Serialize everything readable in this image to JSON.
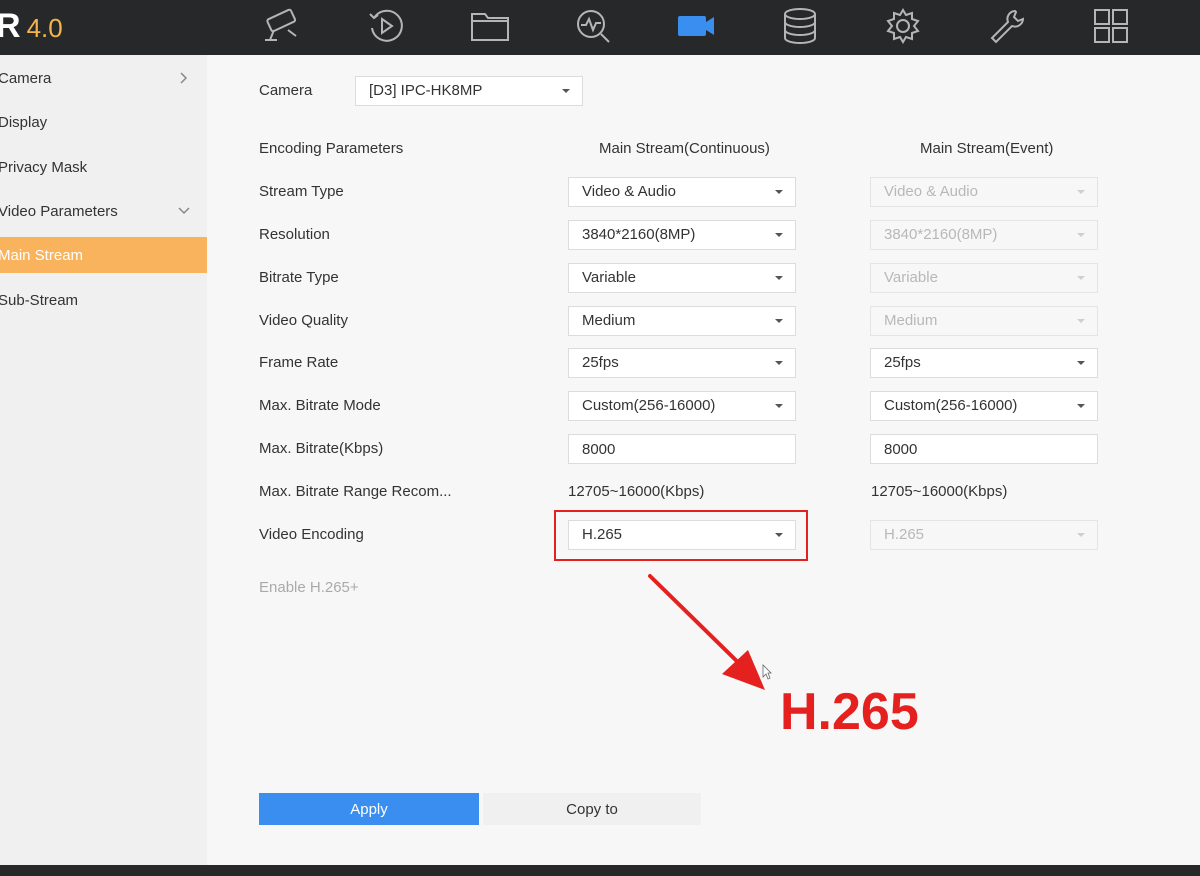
{
  "app": {
    "logo_letter": "R",
    "logo_version": "4.0"
  },
  "nav_icons": [
    "camera-icon",
    "playback-icon",
    "folder-icon",
    "search-analysis-icon",
    "video-icon",
    "storage-icon",
    "settings-icon",
    "maintenance-icon",
    "grid-icon"
  ],
  "sidebar": {
    "items": [
      {
        "label": "Camera"
      },
      {
        "label": "Display"
      },
      {
        "label": "Privacy Mask"
      },
      {
        "label": "Video Parameters"
      },
      {
        "label": "Main Stream"
      },
      {
        "label": "Sub-Stream"
      }
    ]
  },
  "camera": {
    "label": "Camera",
    "value": "[D3] IPC-HK8MP"
  },
  "columns": {
    "params": "Encoding Parameters",
    "continuous": "Main Stream(Continuous)",
    "event": "Main Stream(Event)"
  },
  "rows": {
    "stream_type": {
      "label": "Stream Type",
      "continuous": "Video & Audio",
      "event": "Video & Audio"
    },
    "resolution": {
      "label": "Resolution",
      "continuous": "3840*2160(8MP)",
      "event": "3840*2160(8MP)"
    },
    "bitrate_type": {
      "label": "Bitrate Type",
      "continuous": "Variable",
      "event": "Variable"
    },
    "video_quality": {
      "label": "Video Quality",
      "continuous": "Medium",
      "event": "Medium"
    },
    "frame_rate": {
      "label": "Frame Rate",
      "continuous": "25fps",
      "event": "25fps"
    },
    "max_bitrate_mode": {
      "label": "Max. Bitrate Mode",
      "continuous": "Custom(256-16000)",
      "event": "Custom(256-16000)"
    },
    "max_bitrate": {
      "label": "Max. Bitrate(Kbps)",
      "continuous": "8000",
      "event": "8000"
    },
    "range_recom": {
      "label": "Max. Bitrate Range Recom...",
      "continuous": "12705~16000(Kbps)",
      "event": "12705~16000(Kbps)"
    },
    "video_encoding": {
      "label": "Video Encoding",
      "continuous": "H.265",
      "event": "H.265"
    }
  },
  "enable_h265plus": {
    "label": "Enable H.265+"
  },
  "annotation": {
    "text": "H.265",
    "color": "#e5211f"
  },
  "buttons": {
    "apply": "Apply",
    "copy": "Copy to"
  },
  "colors": {
    "accent_orange": "#f9b35c",
    "primary_blue": "#3a8ef0",
    "topbar": "#27282a",
    "highlight_red": "#e5211f"
  }
}
